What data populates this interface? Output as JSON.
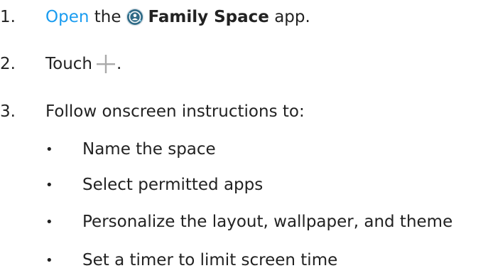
{
  "steps": [
    {
      "number": "1.",
      "link_text": "Open",
      "text_before_icon": " the",
      "app_icon": "family-space-app-icon",
      "app_name": "Family Space",
      "text_after": " app."
    },
    {
      "number": "2.",
      "text": "Touch",
      "icon": "plus-icon",
      "text_after": "."
    },
    {
      "number": "3.",
      "text": "Follow onscreen instructions to:"
    }
  ],
  "sub_items": [
    "Name the space",
    "Select permitted apps",
    "Personalize the layout, wallpaper, and theme",
    "Set a timer to limit screen time"
  ],
  "bullet_glyph": "•",
  "colors": {
    "link": "#1a9cf0",
    "text": "#222222",
    "icon_bg": "#2e6a86",
    "plus": "#aaaaaa"
  }
}
